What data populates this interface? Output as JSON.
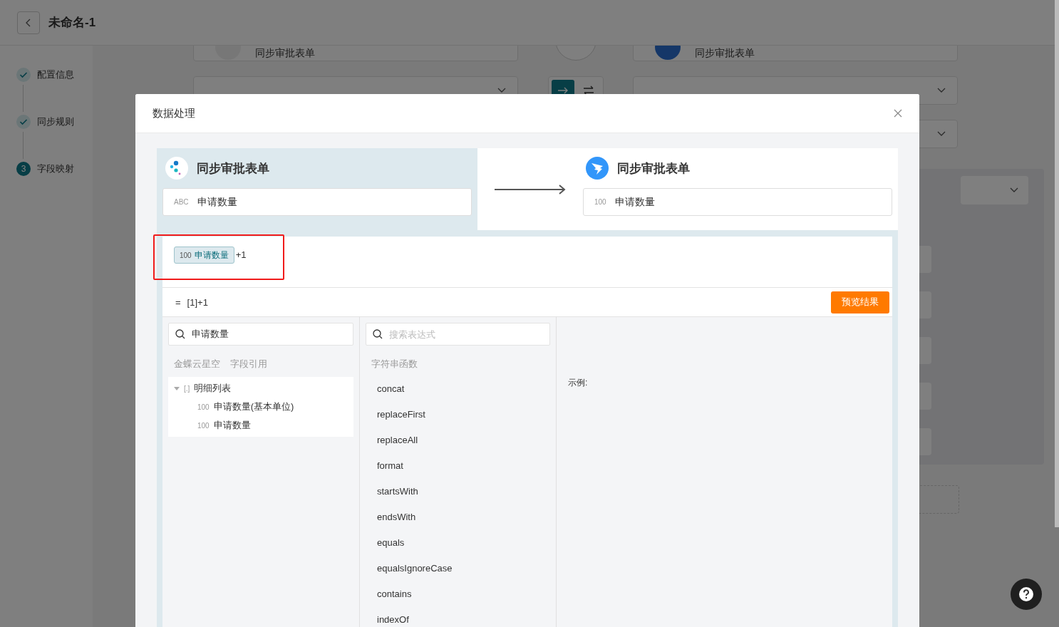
{
  "header": {
    "title": "未命名-1"
  },
  "steps": [
    {
      "label": "配置信息",
      "completed": true
    },
    {
      "label": "同步规则",
      "completed": true
    },
    {
      "number": "3",
      "label": "字段映射",
      "completed": false
    }
  ],
  "background": {
    "source_app": "同步审批表单",
    "target_app": "同步审批表单",
    "direction_buttons": [
      {
        "selected": true
      },
      {
        "selected": false
      }
    ]
  },
  "dialog": {
    "title": "数据处理",
    "source": {
      "app": "同步审批表单",
      "type_tag": "ABC",
      "field": "申请数量"
    },
    "target": {
      "app": "同步审批表单",
      "type_tag": "100",
      "field": "申请数量"
    },
    "formula": {
      "chip_tag": "100",
      "chip_label": "申请数量",
      "suffix": "+1",
      "highlighted": true
    },
    "expression": {
      "prefix": "=",
      "value": "[1]+1"
    },
    "preview_button": "预览结果",
    "field_search": {
      "value": "申请数量"
    },
    "field_tabs": [
      "金蝶云星空",
      "字段引用"
    ],
    "field_tree": [
      {
        "type_tag": "[.]",
        "label": "明细列表",
        "expanded": true,
        "children": [
          {
            "type_tag": "100",
            "label": "申请数量(基本单位)"
          },
          {
            "type_tag": "100",
            "label": "申请数量"
          }
        ]
      }
    ],
    "function_search": {
      "placeholder": "搜索表达式"
    },
    "function_group": "字符串函数",
    "functions": [
      "concat",
      "replaceFirst",
      "replaceAll",
      "format",
      "startsWith",
      "endsWith",
      "equals",
      "equalsIgnoreCase",
      "contains",
      "indexOf"
    ],
    "example_label": "示例:"
  }
}
